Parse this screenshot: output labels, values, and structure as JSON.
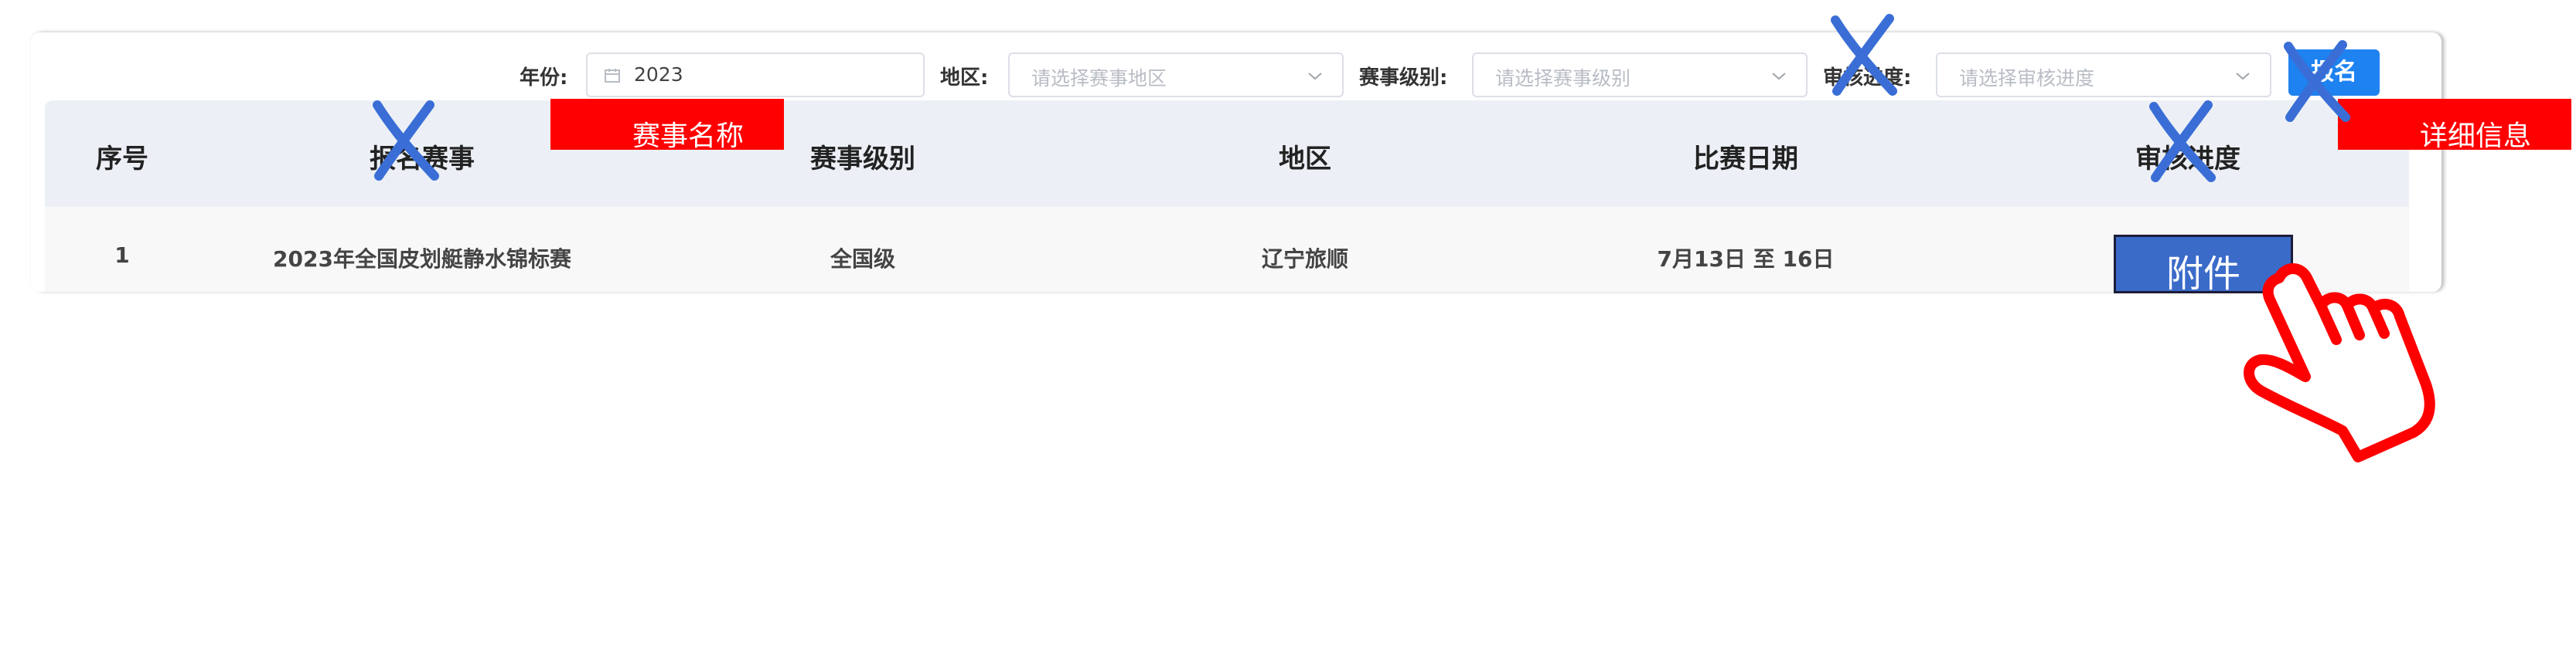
{
  "filters": {
    "year_label": "年份:",
    "year_value": "2023",
    "region_label": "地区:",
    "region_placeholder": "请选择赛事地区",
    "level_label": "赛事级别:",
    "level_placeholder": "请选择赛事级别",
    "review_label": "审核进度:",
    "review_placeholder": "请选择审核进度",
    "search_button": "报名"
  },
  "table": {
    "headers": [
      "序号",
      "报名赛事",
      "赛事级别",
      "地区",
      "比赛日期",
      "审核进度"
    ],
    "rows": [
      {
        "index": "1",
        "event": "2023年全国皮划艇静水锦标赛",
        "level": "全国级",
        "region": "辽宁旅顺",
        "date": "7月13日 至 16日",
        "action": "附件"
      }
    ]
  },
  "annotations": {
    "event_name_label": "赛事名称",
    "detail_label": "详细信息",
    "accent_color": "#ff0000",
    "cross_color": "#3a6ed6"
  },
  "icons": {
    "calendar": "calendar-icon",
    "dropdown": "chevron-down-icon",
    "pointer": "hand-pointer-icon",
    "cross": "cross-mark-icon"
  }
}
